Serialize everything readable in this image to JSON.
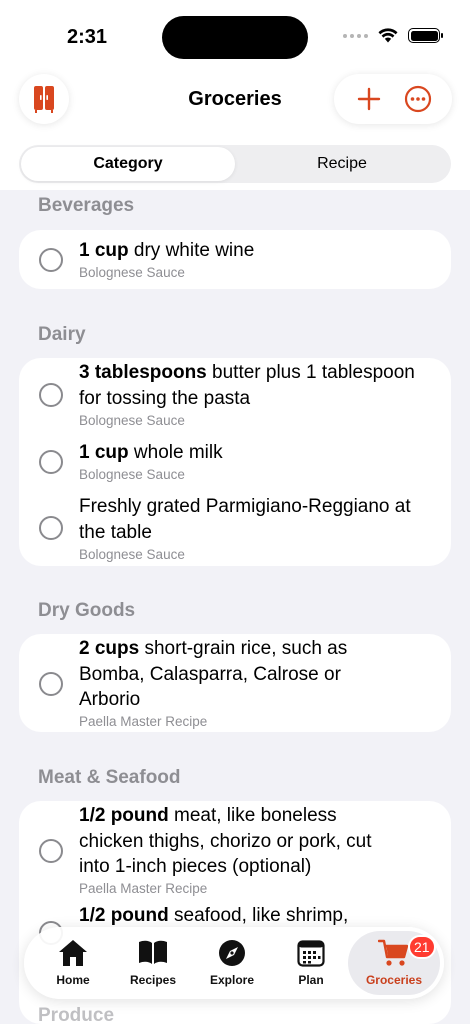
{
  "status_bar": {
    "time": "2:31"
  },
  "nav": {
    "title": "Groceries"
  },
  "segmented": {
    "options": [
      "Category",
      "Recipe"
    ],
    "selected": "Category"
  },
  "sections": [
    {
      "title": "Beverages",
      "items": [
        {
          "qty": "1 cup",
          "name": " dry white wine",
          "recipe": "Bolognese Sauce"
        }
      ]
    },
    {
      "title": "Dairy",
      "items": [
        {
          "qty": "3 tablespoons",
          "name": " butter plus 1 tablespoon for tossing the pasta",
          "recipe": "Bolognese Sauce"
        },
        {
          "qty": "1 cup",
          "name": " whole milk",
          "recipe": "Bolognese Sauce"
        },
        {
          "qty": "",
          "name": "Freshly grated Parmigiano-Reggiano at the table",
          "recipe": "Bolognese Sauce"
        }
      ]
    },
    {
      "title": "Dry Goods",
      "items": [
        {
          "qty": "2 cups",
          "name": " short-grain rice, such as Bomba, Calasparra, Calrose or Arborio",
          "recipe": "Paella Master Recipe"
        }
      ]
    },
    {
      "title": "Meat & Seafood",
      "items": [
        {
          "qty": "1/2 pound",
          "name": " meat, like boneless chicken thighs, chorizo or pork, cut into 1-inch pieces (optional)",
          "recipe": "Paella Master Recipe"
        },
        {
          "qty": "1/2 pound",
          "name": " seafood, like shrimp,",
          "recipe": ""
        }
      ]
    },
    {
      "title": "Produce",
      "items": []
    }
  ],
  "tab_bar": {
    "tabs": [
      {
        "label": "Home",
        "icon": "house-icon"
      },
      {
        "label": "Recipes",
        "icon": "book-icon"
      },
      {
        "label": "Explore",
        "icon": "compass-icon"
      },
      {
        "label": "Plan",
        "icon": "calendar-icon"
      },
      {
        "label": "Groceries",
        "icon": "cart-icon",
        "badge": "21"
      }
    ],
    "active": "Groceries"
  },
  "colors": {
    "accent": "#d9471f",
    "badge": "#ff3b30",
    "secondary_text": "#8e8e93",
    "background": "#f2f2f7"
  }
}
